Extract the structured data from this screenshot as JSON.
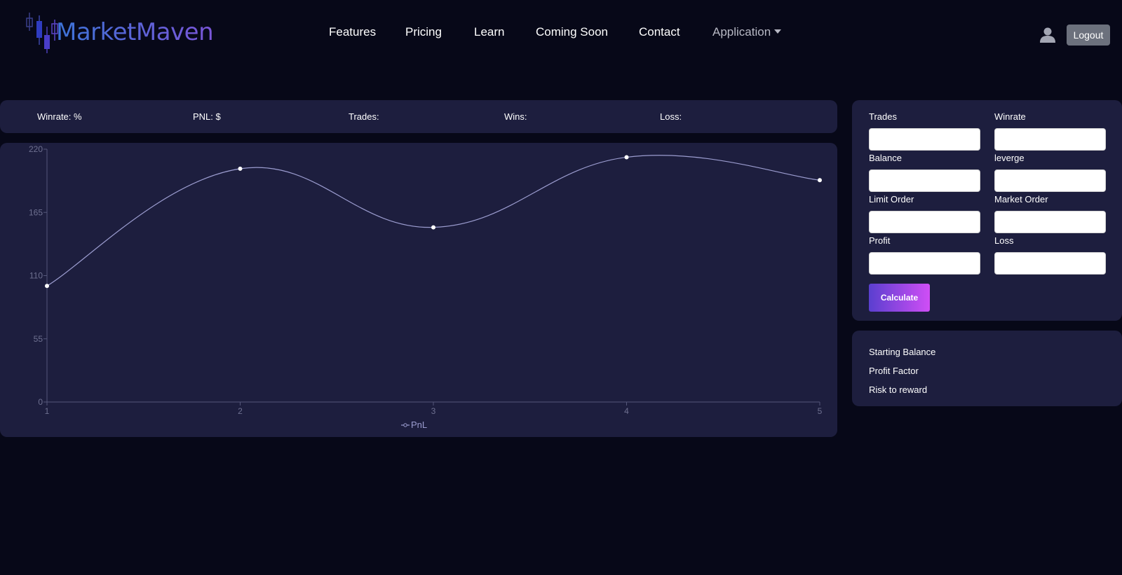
{
  "header": {
    "logo_text": "MarketMaven",
    "brand_color_start": "#3c74d8",
    "brand_color_end": "#7a55d8",
    "nav": [
      {
        "label": "Features"
      },
      {
        "label": "Pricing"
      },
      {
        "label": "Learn"
      },
      {
        "label": "Coming Soon"
      },
      {
        "label": "Contact"
      },
      {
        "label": "Application",
        "has_dropdown": true
      }
    ],
    "user_icon": "user-icon",
    "logout_label": "Logout"
  },
  "stats": {
    "winrate_label": "Winrate: %",
    "pnl_label": "PNL: $",
    "trades_label": "Trades:",
    "wins_label": "Wins:",
    "loss_label": "Loss:"
  },
  "chart_data": {
    "type": "line",
    "x": [
      1,
      2,
      3,
      4,
      5
    ],
    "series": [
      {
        "name": "PnL",
        "values": [
          101,
          203,
          152,
          213,
          193
        ]
      }
    ],
    "ylim": [
      0,
      220
    ],
    "yticks": [
      "0",
      "55",
      "110",
      "165",
      "220"
    ],
    "xticks": [
      "1",
      "2",
      "3",
      "4",
      "5"
    ],
    "smooth": true,
    "grid": false,
    "legend": "bottom",
    "line_color": "#9b9ccf",
    "point_color": "#ffffff"
  },
  "calculator": {
    "fields": [
      {
        "label": "Trades",
        "value": ""
      },
      {
        "label": "Winrate",
        "value": ""
      },
      {
        "label": "Balance",
        "value": ""
      },
      {
        "label": "leverge",
        "value": ""
      },
      {
        "label": "Limit Order",
        "value": ""
      },
      {
        "label": "Market Order",
        "value": ""
      },
      {
        "label": "Profit",
        "value": ""
      },
      {
        "label": "Loss",
        "value": ""
      }
    ],
    "button_label": "Calculate",
    "button_gradient_start": "#5a3fcf",
    "button_gradient_end": "#d04ef6"
  },
  "results": {
    "items": [
      {
        "label": "Starting Balance"
      },
      {
        "label": "Profit Factor"
      },
      {
        "label": "Risk to reward"
      }
    ]
  }
}
